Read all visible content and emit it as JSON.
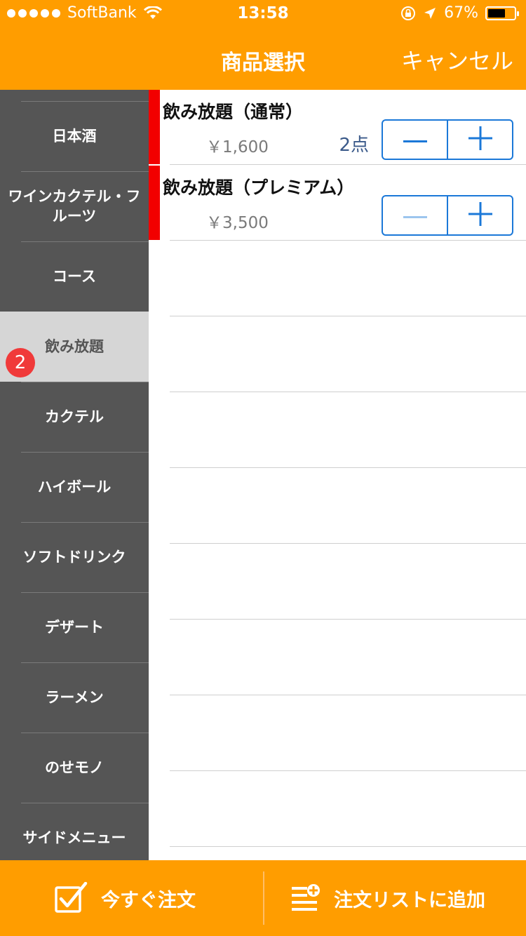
{
  "status_bar": {
    "carrier": "SoftBank",
    "time": "13:58",
    "battery": "67%",
    "battery_level": 0.67,
    "icons": [
      "signal-dots",
      "wifi-icon",
      "rotation-lock-icon",
      "location-arrow-icon",
      "battery-icon"
    ]
  },
  "nav": {
    "title": "商品選択",
    "cancel": "キャンセル"
  },
  "sidebar": {
    "items": [
      {
        "label": "日本酒"
      },
      {
        "label": "ワインカクテル・フルーツ"
      },
      {
        "label": "コース"
      },
      {
        "label": "飲み放題",
        "selected": true,
        "badge": "2"
      },
      {
        "label": "カクテル"
      },
      {
        "label": "ハイボール"
      },
      {
        "label": "ソフトドリンク"
      },
      {
        "label": "デザート"
      },
      {
        "label": "ラーメン"
      },
      {
        "label": "のせモノ"
      },
      {
        "label": "サイドメニュー"
      }
    ]
  },
  "items": [
    {
      "name": "飲み放題（通常）",
      "price": "￥1,600",
      "count": "2点",
      "minus_enabled": true
    },
    {
      "name": "飲み放題（プレミアム）",
      "price": "￥3,500",
      "count": "",
      "minus_enabled": false
    }
  ],
  "colors": {
    "brand": "#FF9D00",
    "stepper": "#1B78D8",
    "stepper_disabled": "#9CC5EE",
    "selected_marker": "#F20000",
    "badge": "#F03A3A",
    "sidebar_bg": "#555555",
    "sidebar_selected_bg": "#D6D6D6"
  },
  "toolbar": {
    "order_now": "今すぐ注文",
    "add_to_list": "注文リストに追加"
  }
}
